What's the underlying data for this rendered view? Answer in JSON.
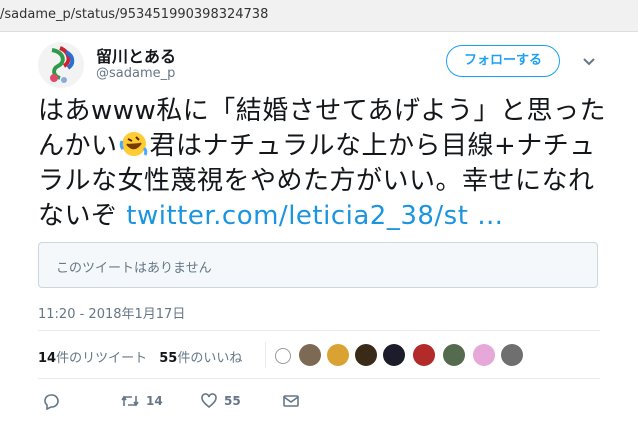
{
  "browser": {
    "url": "/sadame_p/status/953451990398324738"
  },
  "tweet": {
    "display_name": "留川とある",
    "handle": "@sadame_p",
    "follow_label": "フォローする",
    "text_part1": "はあwww私に「結婚させてあげよう」と思ったんかい",
    "text_part2": "君はナチュラルな上から目線+ナチュラルな女性蔑視をやめた方がいい。幸せになれないぞ ",
    "link_text": "twitter.com/leticia2_38/st …",
    "quote_unavailable": "このツイートはありません",
    "timestamp": "11:20 - 2018年1月17日",
    "retweet_count_label": "14件のリツイート",
    "retweet_count_num": "14",
    "retweet_count_suffix": "件のリツイート",
    "like_count_num": "55",
    "like_count_suffix": "件のいいね",
    "action_retweet_count": "14",
    "action_like_count": "55"
  },
  "colors": {
    "accent": "#1da1f2",
    "link": "#1b95e0",
    "muted": "#657786",
    "border": "#e6ecf0"
  },
  "icons": {
    "caret": "chevron-down-icon",
    "reply": "reply-icon",
    "retweet": "retweet-icon",
    "like": "heart-icon",
    "dm": "envelope-icon",
    "emoji": "rolling-on-floor-laughing-emoji"
  }
}
